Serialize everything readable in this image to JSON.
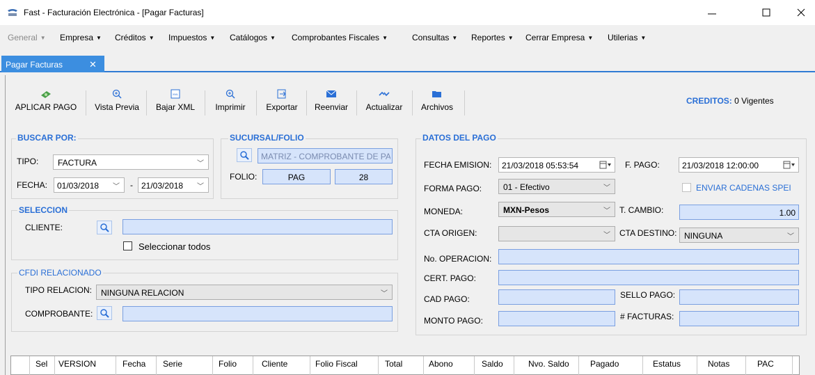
{
  "window": {
    "title": "Fast - Facturación Electrónica - [Pagar Facturas]",
    "minimize": "—",
    "maximize": "☐",
    "close": "✕"
  },
  "menu": [
    {
      "label": "General",
      "disabled": true
    },
    {
      "label": "Empresa"
    },
    {
      "label": "Créditos"
    },
    {
      "label": "Impuestos"
    },
    {
      "label": "Catálogos"
    },
    {
      "label": "Comprobantes Fiscales"
    },
    {
      "label": "Consultas"
    },
    {
      "label": "Reportes"
    },
    {
      "label": "Cerrar Empresa"
    },
    {
      "label": "Utilerias"
    }
  ],
  "tab": {
    "label": "Pagar Facturas",
    "close": "✕"
  },
  "toolbar": {
    "aplicar": "APLICAR PAGO",
    "vista_previa": "Vista Previa",
    "bajar_xml": "Bajar XML",
    "imprimir": "Imprimir",
    "exportar": "Exportar",
    "reenviar": "Reenviar",
    "actualizar": "Actualizar",
    "archivos": "Archivos"
  },
  "creditos": {
    "label": "CREDITOS:",
    "value": "0 Vigentes"
  },
  "buscar": {
    "title": "BUSCAR POR:",
    "tipo_label": "TIPO:",
    "tipo_value": "FACTURA",
    "fecha_label": "FECHA:",
    "fecha_desde": "01/03/2018",
    "fecha_sep": "-",
    "fecha_hasta": "21/03/2018"
  },
  "sucursal": {
    "title": "SUCURSAL/FOLIO",
    "sucursal_value": "MATRIZ - COMPROBANTE DE PA",
    "folio_label": "FOLIO:",
    "serie": "PAG",
    "folio": "28"
  },
  "seleccion": {
    "title": "SELECCION",
    "cliente_label": "CLIENTE:",
    "cliente_value": "",
    "seleccionar_todos": "Seleccionar todos"
  },
  "cfdi": {
    "title": "CFDI RELACIONADO",
    "tipo_relacion_label": "TIPO RELACION:",
    "tipo_relacion_value": "NINGUNA RELACION",
    "comprobante_label": "COMPROBANTE:",
    "comprobante_value": ""
  },
  "datos_pago": {
    "title": "DATOS DEL PAGO",
    "fecha_emision_label": "FECHA EMISION:",
    "fecha_emision_value": "21/03/2018 05:53:54",
    "f_pago_label": "F. PAGO:",
    "f_pago_value": "21/03/2018 12:00:00",
    "forma_pago_label": "FORMA PAGO:",
    "forma_pago_value": "01 - Efectivo",
    "enviar_cadenas": "ENVIAR CADENAS SPEI",
    "moneda_label": "MONEDA:",
    "moneda_value": "MXN-Pesos",
    "t_cambio_label": "T. CAMBIO:",
    "t_cambio_value": "1.00",
    "cta_origen_label": "CTA ORIGEN:",
    "cta_origen_value": "",
    "cta_destino_label": "CTA DESTINO:",
    "cta_destino_value": "NINGUNA",
    "no_operacion_label": "No. OPERACION:",
    "cert_pago_label": "CERT. PAGO:",
    "cad_pago_label": "CAD PAGO:",
    "sello_pago_label": "SELLO PAGO:",
    "monto_pago_label": "MONTO PAGO:",
    "facturas_label": "# FACTURAS:"
  },
  "grid": {
    "columns": [
      "Sel",
      "VERSION",
      "Fecha",
      "Serie",
      "Folio",
      "Cliente",
      "Folio Fiscal",
      "Total",
      "Abono",
      "Saldo",
      "Nvo. Saldo",
      "Pagado",
      "Estatus",
      "Notas",
      "PAC"
    ]
  },
  "colors": {
    "accent": "#2a6fd6",
    "tab": "#3c8ee0",
    "field": "#d6e4fb"
  }
}
